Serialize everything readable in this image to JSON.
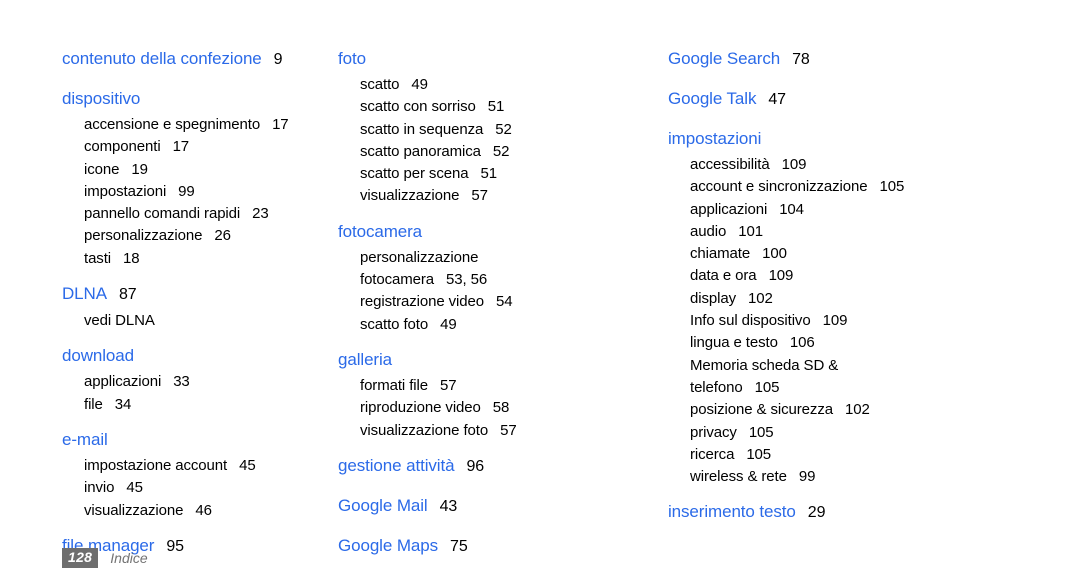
{
  "page": {
    "title": "Indice",
    "footer_page_number": "128",
    "footer_label": "Indice",
    "heading_color": "#2b6ae8",
    "text_color": "#000000",
    "badge_color": "#6e6e6e",
    "background": "#ffffff"
  },
  "columns": [
    {
      "groups": [
        {
          "heading": "contenuto della confezione",
          "heading_page": "9",
          "entries": []
        },
        {
          "heading": "dispositivo",
          "heading_page": "",
          "entries": [
            {
              "label": "accensione e spegnimento",
              "page": "17"
            },
            {
              "label": "componenti",
              "page": "17"
            },
            {
              "label": "icone",
              "page": "19"
            },
            {
              "label": "impostazioni",
              "page": "99"
            },
            {
              "label": "pannello comandi rapidi",
              "page": "23"
            },
            {
              "label": "personalizzazione",
              "page": "26"
            },
            {
              "label": "tasti",
              "page": "18"
            }
          ]
        },
        {
          "heading": "DLNA",
          "heading_page": "87",
          "entries": [
            {
              "label": "vedi DLNA",
              "page": ""
            }
          ]
        },
        {
          "heading": "download",
          "heading_page": "",
          "entries": [
            {
              "label": "applicazioni",
              "page": "33"
            },
            {
              "label": "file",
              "page": "34"
            }
          ]
        },
        {
          "heading": "e-mail",
          "heading_page": "",
          "entries": [
            {
              "label": "impostazione account",
              "page": "45"
            },
            {
              "label": "invio",
              "page": "45"
            },
            {
              "label": "visualizzazione",
              "page": "46"
            }
          ]
        },
        {
          "heading": "file manager",
          "heading_page": "95",
          "entries": []
        }
      ]
    },
    {
      "groups": [
        {
          "heading": "foto",
          "heading_page": "",
          "entries": [
            {
              "label": "scatto",
              "page": "49"
            },
            {
              "label": "scatto con sorriso",
              "page": "51"
            },
            {
              "label": "scatto in sequenza",
              "page": "52"
            },
            {
              "label": "scatto panoramica",
              "page": "52"
            },
            {
              "label": "scatto per scena",
              "page": "51"
            },
            {
              "label": "visualizzazione",
              "page": "57"
            }
          ]
        },
        {
          "heading": "fotocamera",
          "heading_page": "",
          "entries": [
            {
              "label": "personalizzazione",
              "page": ""
            },
            {
              "label": "fotocamera",
              "page": "53, 56"
            },
            {
              "label": "registrazione video",
              "page": "54"
            },
            {
              "label": "scatto foto",
              "page": "49"
            }
          ]
        },
        {
          "heading": "galleria",
          "heading_page": "",
          "entries": [
            {
              "label": "formati file",
              "page": "57"
            },
            {
              "label": "riproduzione video",
              "page": "58"
            },
            {
              "label": "visualizzazione foto",
              "page": "57"
            }
          ]
        },
        {
          "heading": "gestione attività",
          "heading_page": "96",
          "entries": []
        },
        {
          "heading": "Google Mail",
          "heading_page": "43",
          "entries": []
        },
        {
          "heading": "Google Maps",
          "heading_page": "75",
          "entries": []
        }
      ]
    },
    {
      "groups": [
        {
          "heading": "Google Search",
          "heading_page": "78",
          "entries": []
        },
        {
          "heading": "Google Talk",
          "heading_page": "47",
          "entries": []
        },
        {
          "heading": "impostazioni",
          "heading_page": "",
          "entries": [
            {
              "label": "accessibilità",
              "page": "109"
            },
            {
              "label": "account e sincronizzazione",
              "page": "105"
            },
            {
              "label": "applicazioni",
              "page": "104"
            },
            {
              "label": "audio",
              "page": "101"
            },
            {
              "label": "chiamate",
              "page": "100"
            },
            {
              "label": "data e ora",
              "page": "109"
            },
            {
              "label": "display",
              "page": "102"
            },
            {
              "label": "Info sul dispositivo",
              "page": "109"
            },
            {
              "label": "lingua e testo",
              "page": "106"
            },
            {
              "label": "Memoria scheda SD &",
              "page": ""
            },
            {
              "label": "telefono",
              "page": "105"
            },
            {
              "label": "posizione & sicurezza",
              "page": "102"
            },
            {
              "label": "privacy",
              "page": "105"
            },
            {
              "label": "ricerca",
              "page": "105"
            },
            {
              "label": "wireless & rete",
              "page": "99"
            }
          ]
        },
        {
          "heading": "inserimento testo",
          "heading_page": "29",
          "entries": []
        }
      ]
    }
  ]
}
